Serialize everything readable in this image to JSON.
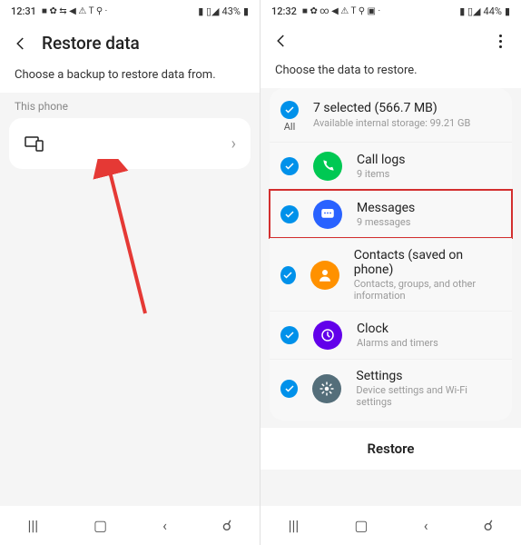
{
  "left": {
    "statusbar": {
      "time": "12:31",
      "icons": "■ ✿ ⇆ ◀ ⚠ T ⚲ ·",
      "battery": "43%",
      "signal": "▮ ▯◢"
    },
    "title": "Restore data",
    "subtitle": "Choose a backup to restore data from.",
    "section": "This phone"
  },
  "right": {
    "statusbar": {
      "time": "12:32",
      "icons": "■ ✿ ∞ ◀ ⚠ T ⚲ ▣ ·",
      "battery": "44%",
      "signal": "▮ ▯◢"
    },
    "subtitle": "Choose the data to restore.",
    "summary": {
      "all_label": "All",
      "main": "7 selected (566.7 MB)",
      "sub": "Available internal storage: 99.21 GB"
    },
    "items": [
      {
        "title": "Call logs",
        "sub": "9 items",
        "color": "#00c853",
        "icon": "phone"
      },
      {
        "title": "Messages",
        "sub": "9 messages",
        "color": "#2962ff",
        "icon": "chat",
        "highlight": true
      },
      {
        "title": "Contacts (saved on phone)",
        "sub": "Contacts, groups, and other information",
        "color": "#ff9100",
        "icon": "person"
      },
      {
        "title": "Clock",
        "sub": "Alarms and timers",
        "color": "#6200ea",
        "icon": "clock"
      },
      {
        "title": "Settings",
        "sub": "Device settings and Wi-Fi settings",
        "color": "#546e7a",
        "icon": "gear"
      }
    ],
    "restore": "Restore"
  }
}
